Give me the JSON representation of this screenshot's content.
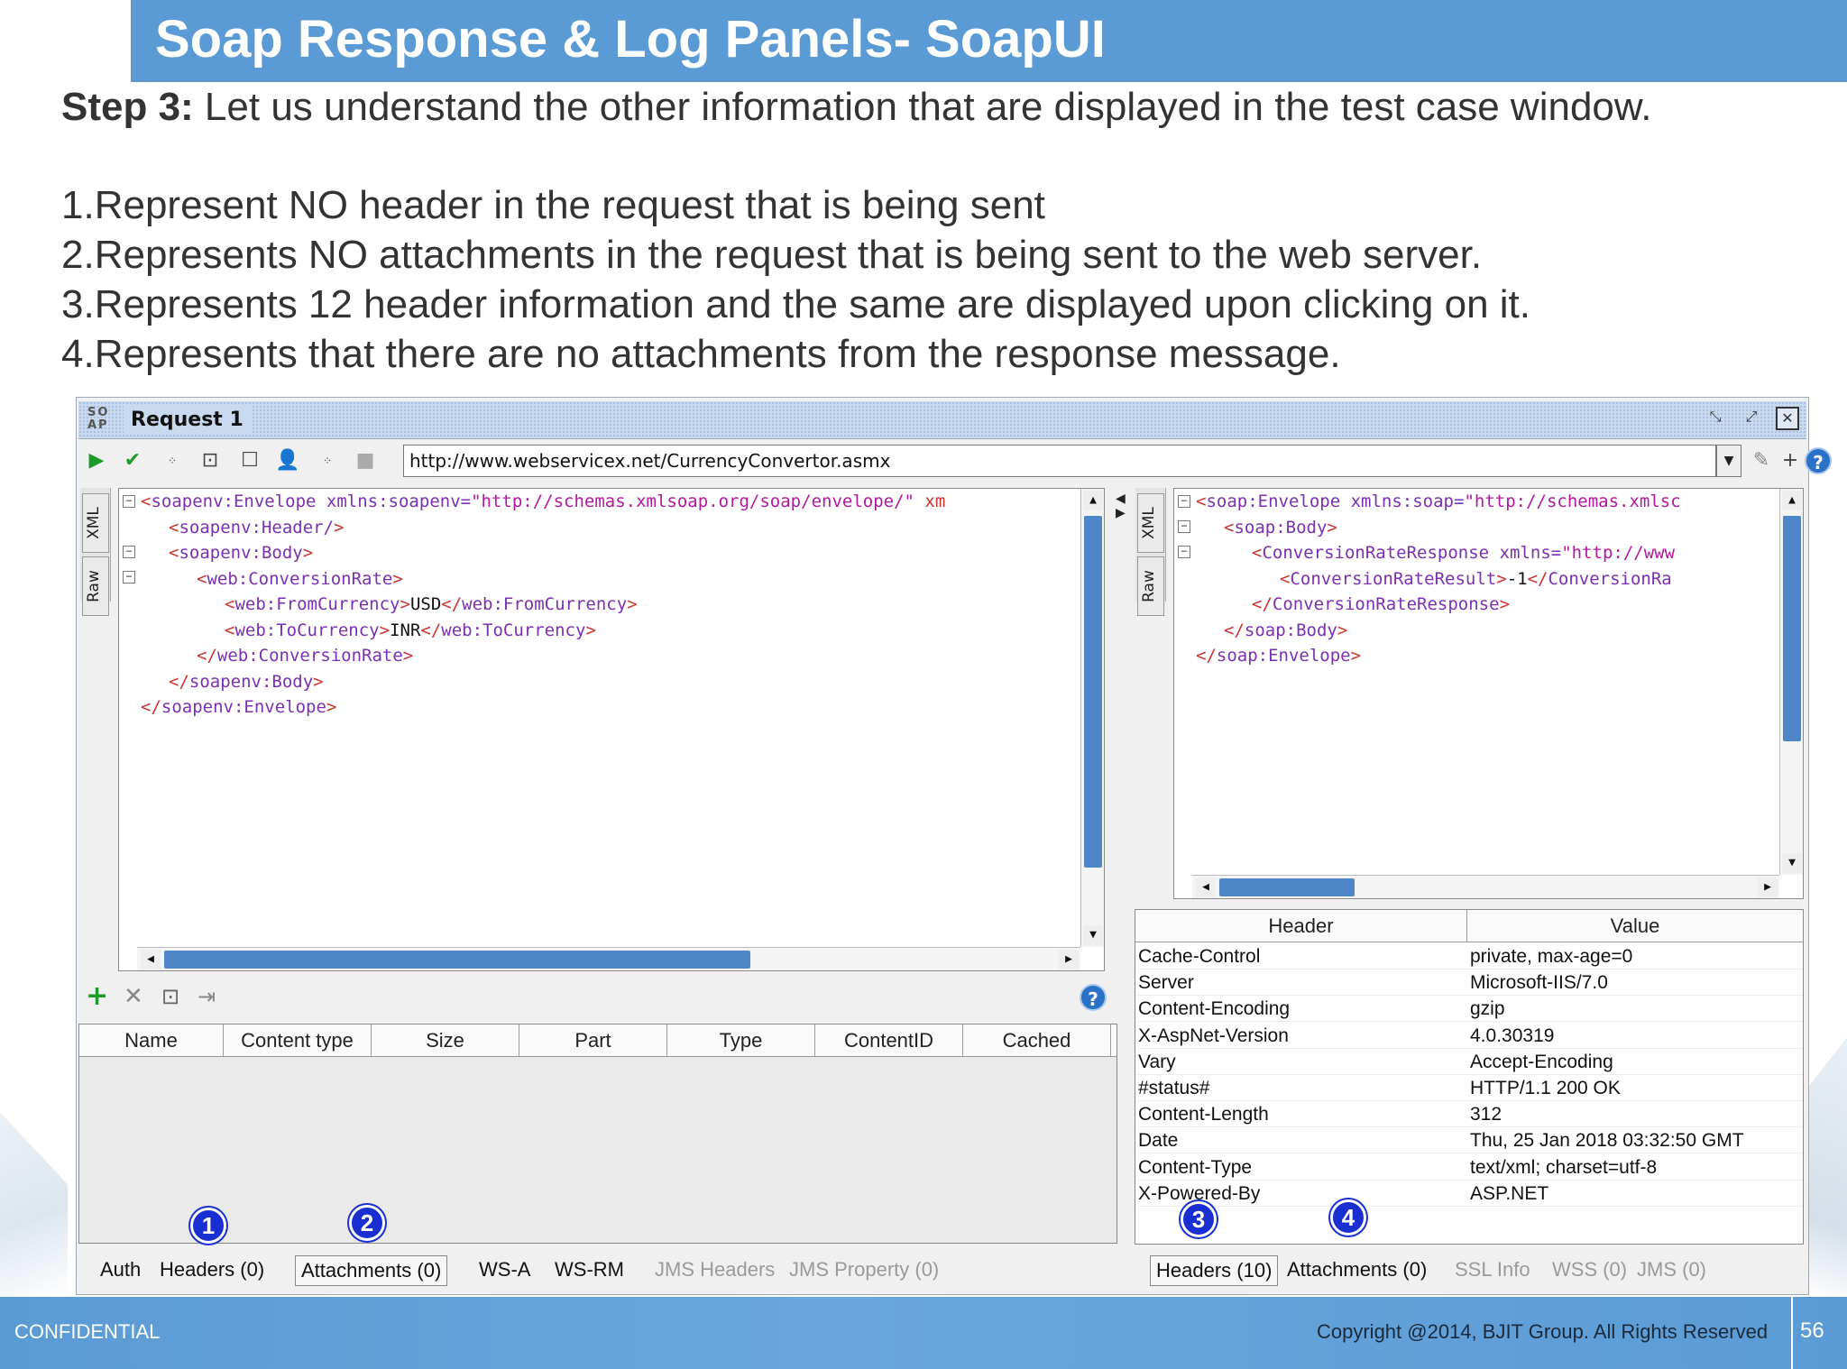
{
  "slide": {
    "title": "Soap Response & Log Panels- SoapUI",
    "step_label": "Step 3:",
    "step_text": " Let us understand the other information that are displayed in the test case window.",
    "items": [
      "1.Represent NO header in the request that is being sent",
      "2.Represents NO attachments in the request that is being sent to the web server.",
      "3.Represents 12 header information and the same are displayed upon clicking on it.",
      "4.Represents that there are no attachments from the response message."
    ],
    "footer_left": "CONFIDENTIAL",
    "footer_right": "Copyright @2014, BJIT Group. All Rights Reserved",
    "page_number": "56",
    "colors": {
      "title_bar": "#5b9bd5",
      "badge": "#1a2fd1",
      "scroll_thumb": "#4e86c7"
    }
  },
  "window": {
    "logo": "SO AP",
    "title": "Request 1",
    "url": "http://www.webservicex.net/CurrencyConvertor.asmx",
    "side_tabs": [
      "XML",
      "Raw"
    ],
    "request_lines": [
      {
        "pre": "<",
        "tag": "soapenv:Envelope",
        "attr": " xmlns:soapenv=",
        "val": "\"http://schemas.xmlsoap.org/soap/envelope/\"",
        "post": " xm"
      },
      {
        "pre": "<",
        "tag": "soapenv:Header/",
        "post": ">"
      },
      {
        "pre": "<",
        "tag": "soapenv:Body",
        "post": ">"
      },
      {
        "pre": "<",
        "tag": "web:ConversionRate",
        "post": ">"
      },
      {
        "pre": "<",
        "tag": "web:FromCurrency",
        "post": ">",
        "text": "USD",
        "close": "</",
        "ctag": "web:FromCurrency",
        "cend": ">"
      },
      {
        "pre": "<",
        "tag": "web:ToCurrency",
        "post": ">",
        "text": "INR",
        "close": "</",
        "ctag": "web:ToCurrency",
        "cend": ">"
      },
      {
        "pre": "</",
        "tag": "web:ConversionRate",
        "post": ">"
      },
      {
        "pre": "</",
        "tag": "soapenv:Body",
        "post": ">"
      },
      {
        "pre": "</",
        "tag": "soapenv:Envelope",
        "post": ">"
      }
    ],
    "response_lines": [
      {
        "pre": "<",
        "tag": "soap:Envelope",
        "attr": " xmlns:soap=",
        "val": "\"http://schemas.xmlsc"
      },
      {
        "pre": "<",
        "tag": "soap:Body",
        "post": ">"
      },
      {
        "pre": "<",
        "tag": "ConversionRateResponse",
        "attr": " xmlns=",
        "val": "\"http://www"
      },
      {
        "pre": "<",
        "tag": "ConversionRateResult",
        "post": ">",
        "text": "-1",
        "close": "</",
        "ctag": "ConversionRa"
      },
      {
        "pre": "</",
        "tag": "ConversionRateResponse",
        "post": ">"
      },
      {
        "pre": "</",
        "tag": "soap:Body",
        "post": ">"
      },
      {
        "pre": "</",
        "tag": "soap:Envelope",
        "post": ">"
      }
    ],
    "attachment_columns": [
      "Name",
      "Content type",
      "Size",
      "Part",
      "Type",
      "ContentID",
      "Cached"
    ],
    "request_tabs": [
      {
        "label": "Auth",
        "dim": false,
        "boxed": false
      },
      {
        "label": "Headers (0)",
        "dim": false,
        "boxed": false
      },
      {
        "label": "Attachments (0)",
        "dim": false,
        "boxed": true
      },
      {
        "label": "WS-A",
        "dim": false,
        "boxed": false
      },
      {
        "label": "WS-RM",
        "dim": false,
        "boxed": false
      },
      {
        "label": "JMS Headers",
        "dim": true,
        "boxed": false
      },
      {
        "label": "JMS Property (0)",
        "dim": true,
        "boxed": false
      }
    ],
    "response_tabs": [
      {
        "label": "Headers (10)",
        "dim": false,
        "boxed": true
      },
      {
        "label": "Attachments (0)",
        "dim": false,
        "boxed": false
      },
      {
        "label": "SSL Info",
        "dim": true,
        "boxed": false
      },
      {
        "label": "WSS (0)",
        "dim": true,
        "boxed": false
      },
      {
        "label": "JMS (0)",
        "dim": true,
        "boxed": false
      }
    ],
    "header_table": {
      "columns": [
        "Header",
        "Value"
      ],
      "rows": [
        [
          "Cache-Control",
          "private, max-age=0"
        ],
        [
          "Server",
          "Microsoft-IIS/7.0"
        ],
        [
          "Content-Encoding",
          "gzip"
        ],
        [
          "X-AspNet-Version",
          "4.0.30319"
        ],
        [
          "Vary",
          "Accept-Encoding"
        ],
        [
          "#status#",
          "HTTP/1.1 200 OK"
        ],
        [
          "Content-Length",
          "312"
        ],
        [
          "Date",
          "Thu, 25 Jan 2018 03:32:50 GMT"
        ],
        [
          "Content-Type",
          "text/xml; charset=utf-8"
        ],
        [
          "X-Powered-By",
          "ASP.NET"
        ]
      ]
    },
    "badges": [
      "1",
      "2",
      "3",
      "4"
    ],
    "help_glyph": "?"
  }
}
